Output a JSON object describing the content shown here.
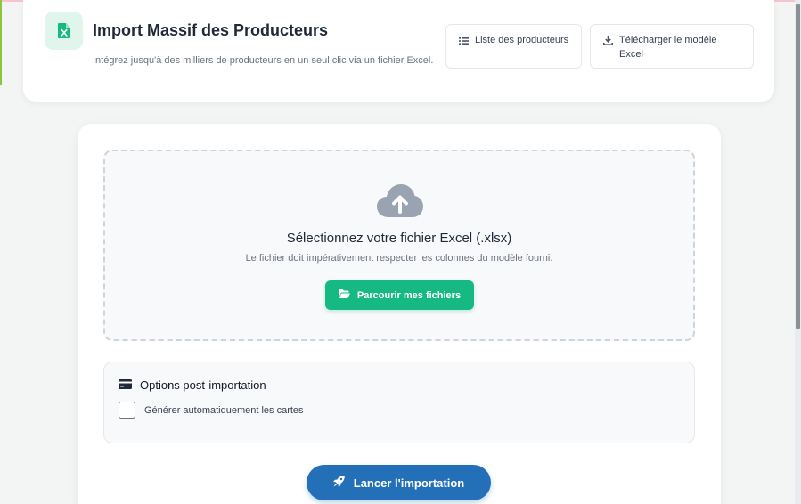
{
  "header": {
    "title": "Import Massif des Producteurs",
    "subtitle": "Intégrez jusqu'à des milliers de producteurs en un seul clic via un fichier Excel.",
    "logo_icon": "excel-file-icon",
    "buttons": {
      "list_label": "Liste des producteurs",
      "list_icon": "list-icon",
      "download_label": "Télécharger le modèle Excel",
      "download_icon": "download-icon"
    }
  },
  "upload": {
    "icon": "cloud-upload-icon",
    "title": "Sélectionnez votre fichier Excel (.xlsx)",
    "hint": "Le fichier doit impérativement respecter les colonnes du modèle fourni.",
    "browse_label": "Parcourir mes fichiers",
    "browse_icon": "folder-open-icon"
  },
  "options": {
    "title": "Options post-importation",
    "title_icon": "credit-card-icon",
    "generate_cards_label": "Générer automatiquement les cartes",
    "generate_cards_checked": false
  },
  "actions": {
    "launch_label": "Lancer l'importation",
    "launch_icon": "rocket-icon"
  },
  "colors": {
    "accent_green": "#16b981",
    "primary_blue": "#2370b8",
    "logo_bg": "#e0f5ec"
  }
}
